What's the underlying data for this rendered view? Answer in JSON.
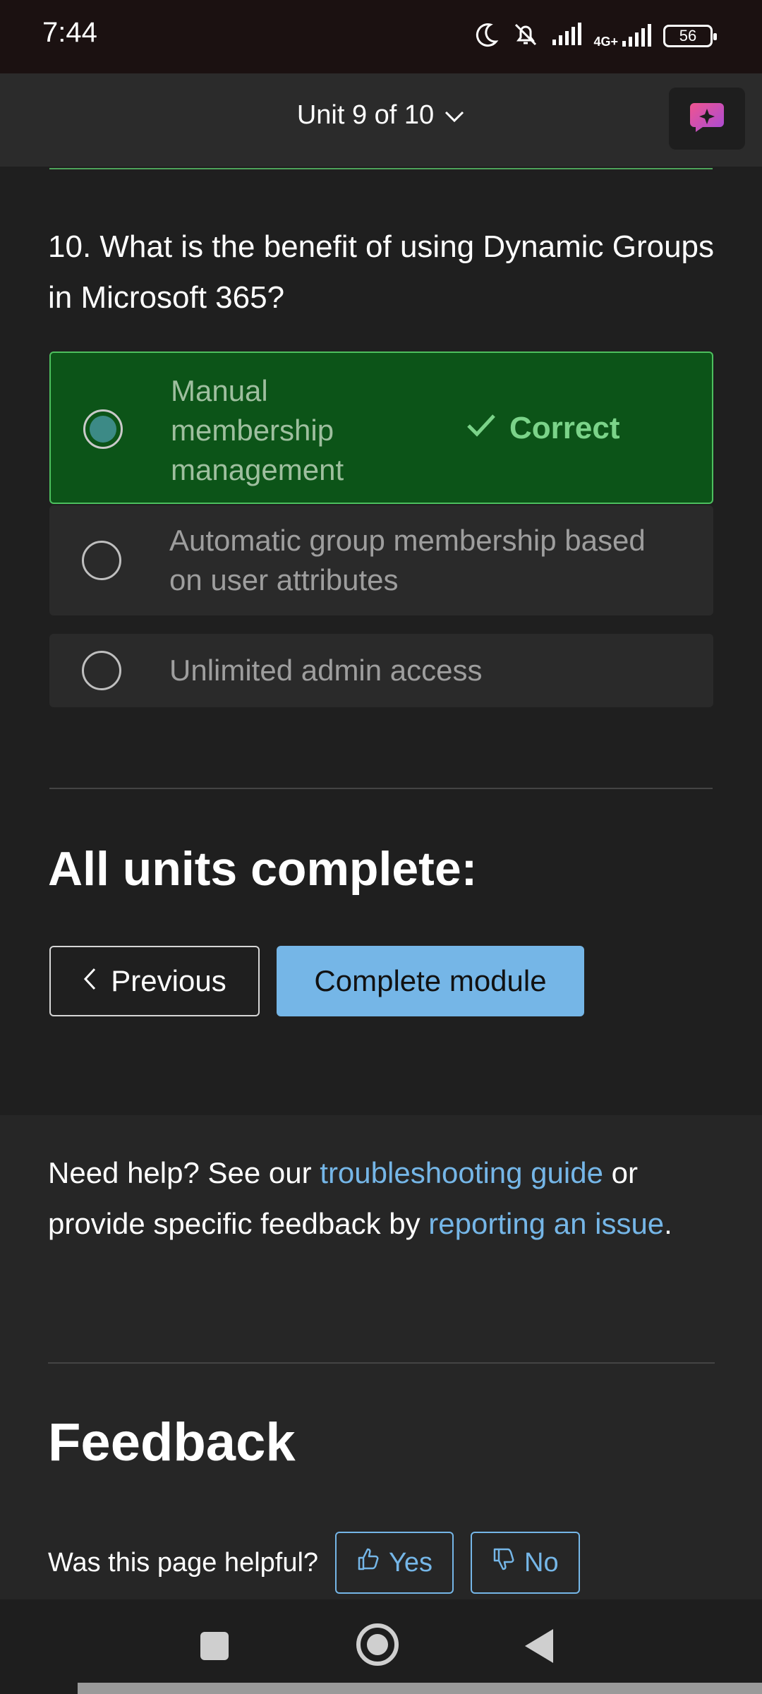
{
  "status_bar": {
    "time": "7:44",
    "network": "4G+",
    "battery": "56",
    "icons": [
      "moon-icon",
      "bell-off-icon",
      "signal-icon",
      "signal-4g-icon",
      "battery-icon"
    ]
  },
  "header": {
    "unit_label": "Unit 9 of 10",
    "icons": [
      "chevron-down-icon",
      "copilot-icon"
    ]
  },
  "quiz": {
    "question": "10. What is the benefit of using Dynamic Groups in Microsoft 365?",
    "options": [
      {
        "label": "Manual membership management",
        "selected": true,
        "status": "Correct"
      },
      {
        "label": "Automatic group membership based on user attributes",
        "selected": false
      },
      {
        "label": "Unlimited admin access",
        "selected": false
      }
    ]
  },
  "completion": {
    "heading": "All units complete:",
    "previous_label": "Previous",
    "complete_label": "Complete module"
  },
  "help": {
    "text_1": "Need help? See our ",
    "link_1": "troubleshooting guide",
    "text_2": " or provide specific feedback by ",
    "link_2": "reporting an issue",
    "text_3": "."
  },
  "feedback": {
    "title": "Feedback",
    "question": "Was this page helpful?",
    "yes_label": "Yes",
    "no_label": "No"
  },
  "colors": {
    "accent": "#75b6e7",
    "correct_bg": "#0c5418",
    "correct_text": "#7bd389"
  }
}
